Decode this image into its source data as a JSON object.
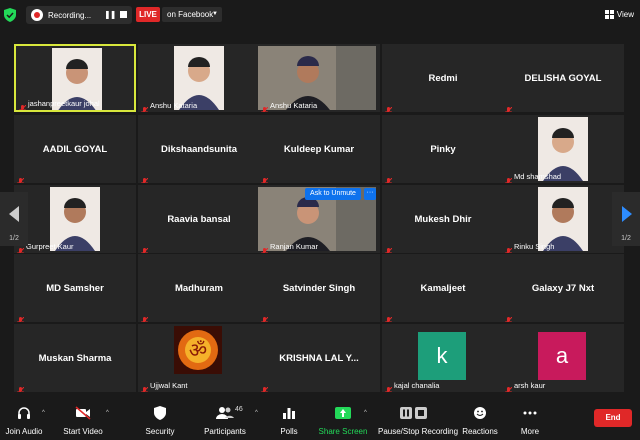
{
  "topbar": {
    "recording_label": "Recording...",
    "live_label": "LIVE",
    "stream_target": "on Facebook",
    "view_label": "View"
  },
  "participants": [
    {
      "display": "name",
      "name": "jashanpreetkaur johal",
      "media": "photo",
      "active": true
    },
    {
      "display": "name",
      "name": "Anshu Kataria",
      "media": "photo"
    },
    {
      "display": "name",
      "name": "Anshu Kataria",
      "media": "video"
    },
    {
      "display": "big",
      "name": "Redmi"
    },
    {
      "display": "big",
      "name": "DELISHA GOYAL"
    },
    {
      "display": "big",
      "name": "AADIL GOYAL"
    },
    {
      "display": "big",
      "name": "Dikshaandsunita"
    },
    {
      "display": "big",
      "name": "Kuldeep Kumar"
    },
    {
      "display": "big",
      "name": "Pinky"
    },
    {
      "display": "name",
      "name": "Md shamshad",
      "media": "photo"
    },
    {
      "display": "name",
      "name": "Gurpreet Kaur",
      "media": "photo"
    },
    {
      "display": "big",
      "name": "Raavia bansal"
    },
    {
      "display": "name",
      "name": "Ranjan Kumar",
      "media": "video"
    },
    {
      "display": "big",
      "name": "Mukesh Dhir"
    },
    {
      "display": "name",
      "name": "Rinku Singh",
      "media": "photo"
    },
    {
      "display": "big",
      "name": "MD Samsher"
    },
    {
      "display": "big",
      "name": "Madhuram"
    },
    {
      "display": "big",
      "name": "Satvinder Singh"
    },
    {
      "display": "big",
      "name": "Kamaljeet"
    },
    {
      "display": "big",
      "name": "Galaxy J7 Nxt"
    },
    {
      "display": "big",
      "name": "Muskan Sharma"
    },
    {
      "display": "name",
      "name": "Ujjwal Kant",
      "media": "om"
    },
    {
      "display": "big",
      "name": "KRISHNA LAL Y..."
    },
    {
      "display": "name",
      "name": "kajal chanalia",
      "media": "letter",
      "letter": "k",
      "color": "#1d9e7a"
    },
    {
      "display": "name",
      "name": "arsh kaur",
      "media": "letter",
      "letter": "a",
      "color": "#c81a5c"
    }
  ],
  "ask_to_unmute": "Ask to Unmute",
  "ask_more": "···",
  "pagination": {
    "left": "1/2",
    "right": "1/2"
  },
  "toolbar": {
    "join_audio": "Join Audio",
    "start_video": "Start Video",
    "security": "Security",
    "participants": "Participants",
    "participant_count": "46",
    "polls": "Polls",
    "share_screen": "Share Screen",
    "pause_stop_recording": "Pause/Stop Recording",
    "reactions": "Reactions",
    "more": "More",
    "end": "End"
  },
  "colors": {
    "background": "#1a1a1a",
    "tile": "#262626",
    "active_border": "#d8e73c",
    "live_red": "#e02828",
    "accent_blue": "#0e72ed",
    "share_green": "#23d959",
    "muted_red": "#e02828"
  }
}
